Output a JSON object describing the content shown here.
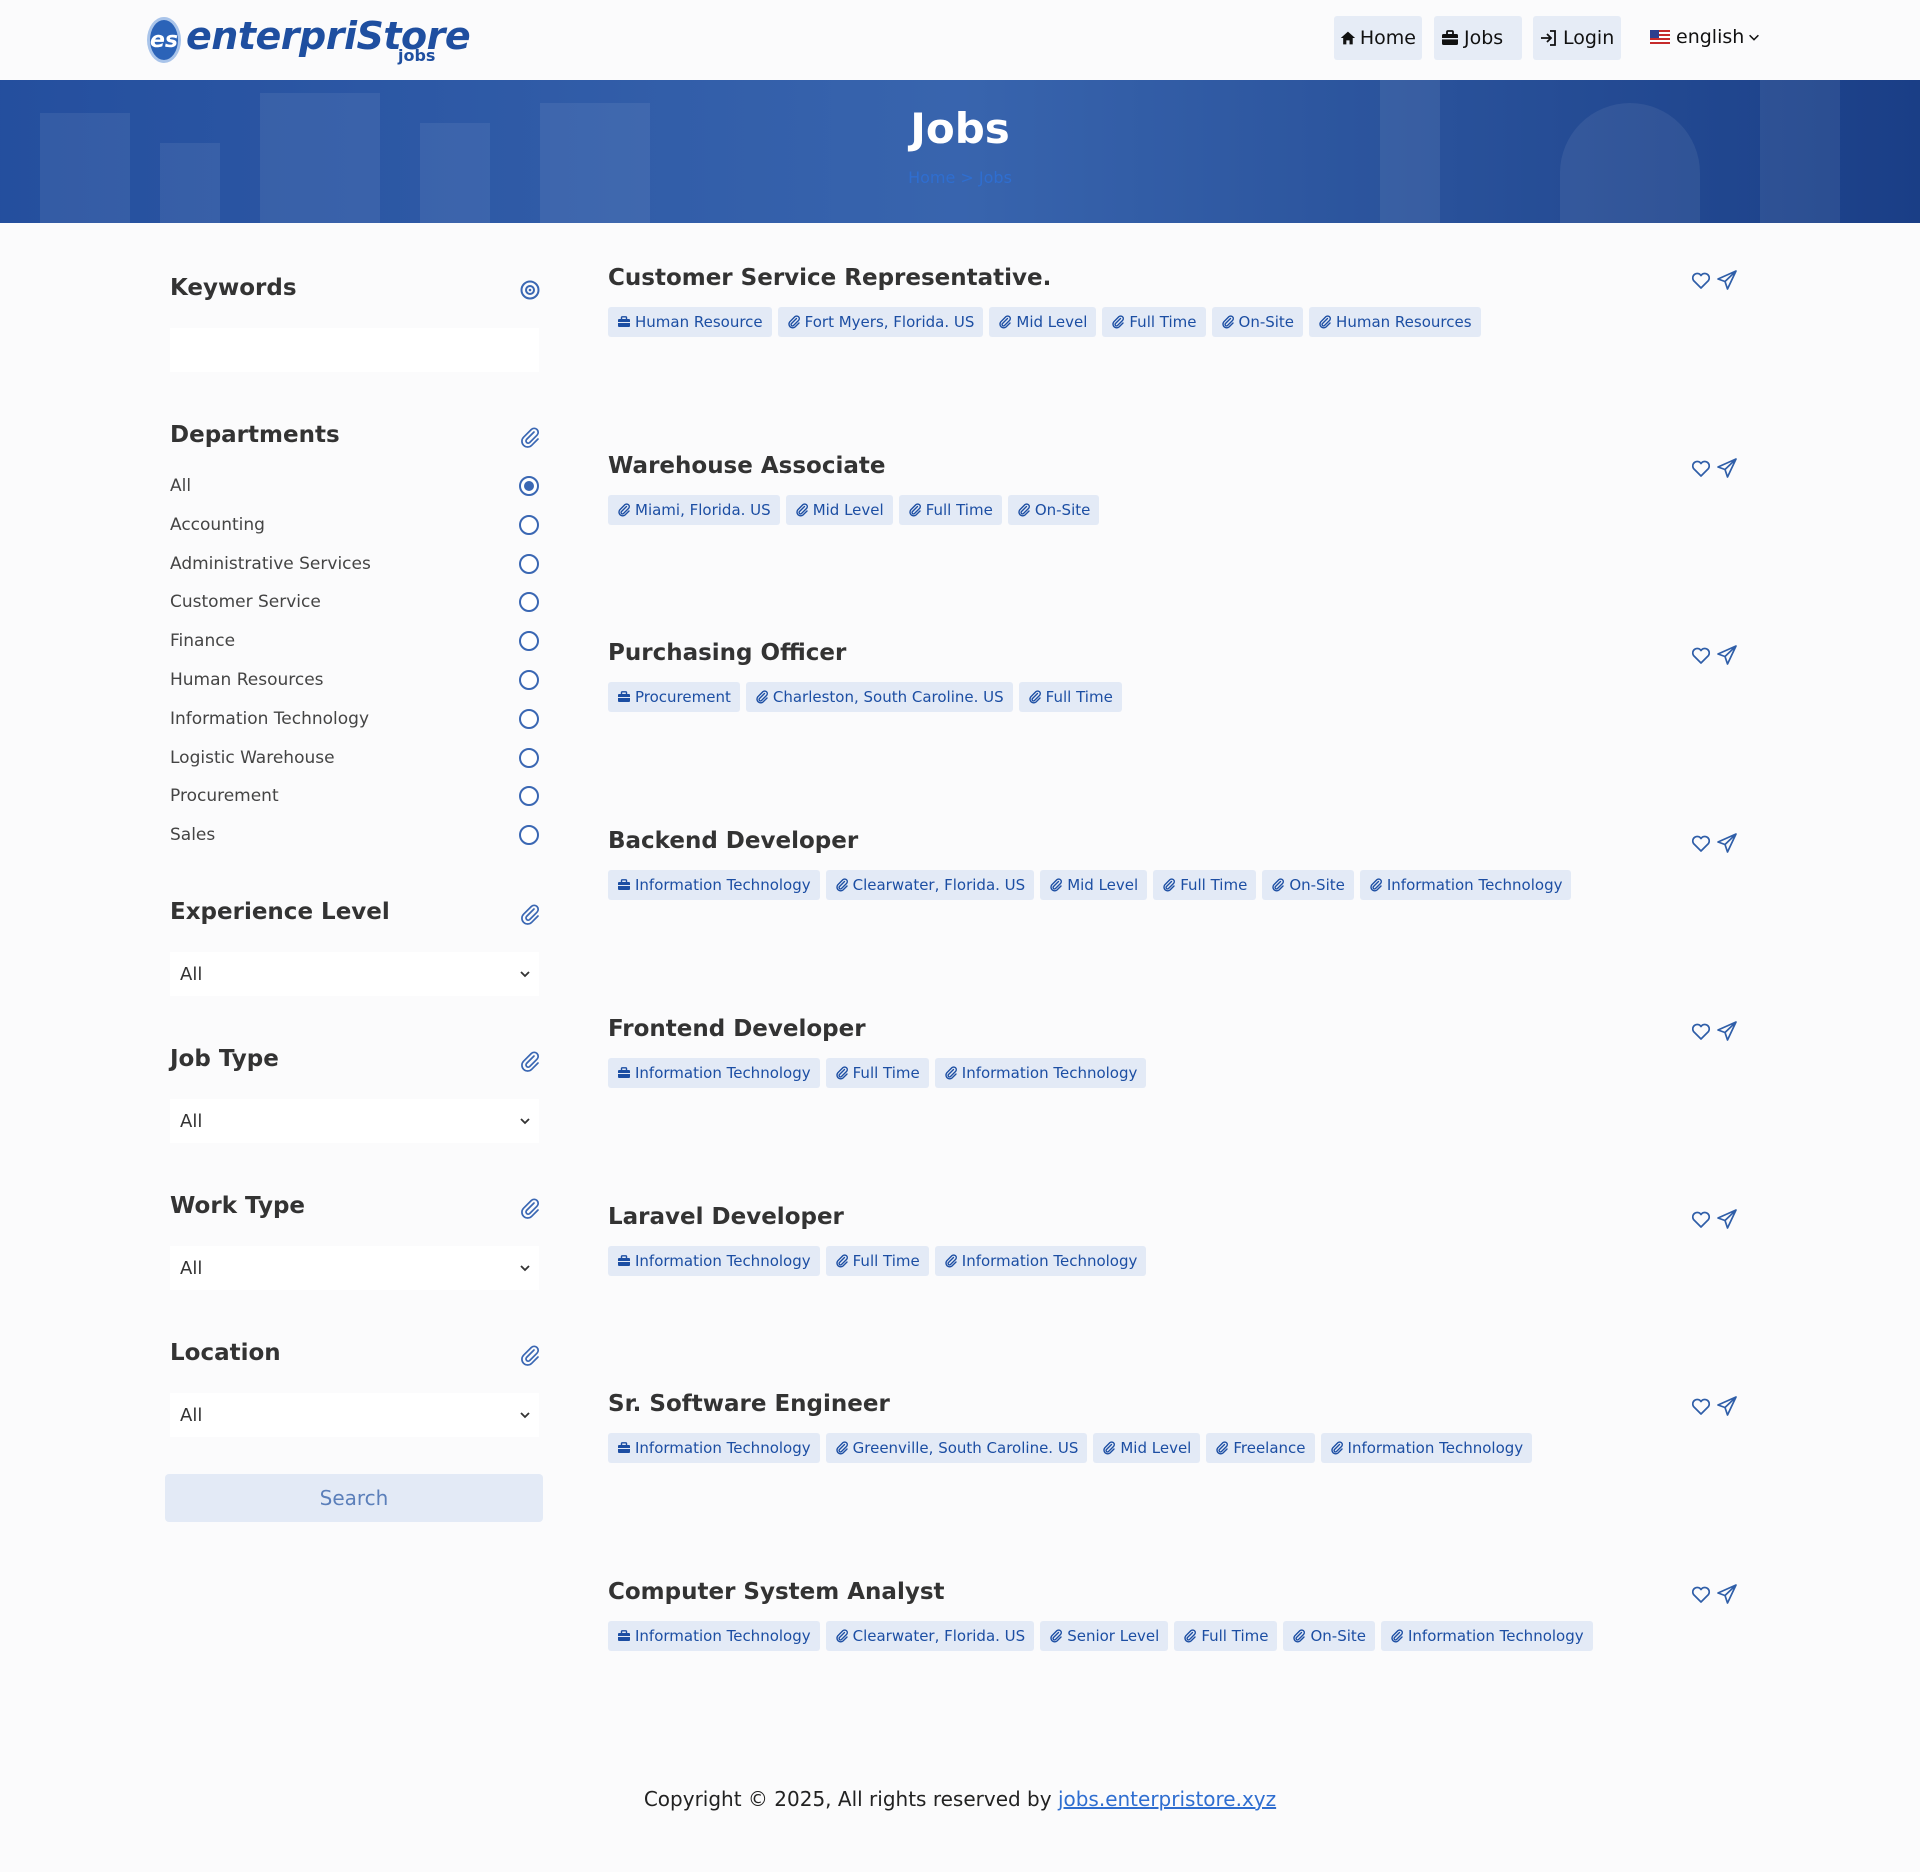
{
  "brand": {
    "logo_badge": "es",
    "logo_text": "enterpriStore",
    "logo_sub": "jobs"
  },
  "nav": {
    "home": "Home",
    "jobs": "Jobs",
    "login": "Login",
    "language": "english"
  },
  "hero": {
    "title": "Jobs",
    "breadcrumb_home": "Home",
    "breadcrumb_sep": ">",
    "breadcrumb_current": "Jobs"
  },
  "sidebar": {
    "keywords_label": "Keywords",
    "keywords_value": "",
    "departments_label": "Departments",
    "departments": [
      "All",
      "Accounting",
      "Administrative Services",
      "Customer Service",
      "Finance",
      "Human Resources",
      "Information Technology",
      "Logistic Warehouse",
      "Procurement",
      "Sales"
    ],
    "selected_department": "All",
    "experience_label": "Experience Level",
    "experience_value": "All",
    "jobtype_label": "Job Type",
    "jobtype_value": "All",
    "worktype_label": "Work Type",
    "worktype_value": "All",
    "location_label": "Location",
    "location_value": "All",
    "search_label": "Search"
  },
  "jobs": [
    {
      "title": "Customer Service Representative.",
      "tags": [
        {
          "icon": "briefcase-icon",
          "text": "Human Resource"
        },
        {
          "icon": "paperclip-icon",
          "text": "Fort Myers, Florida. US"
        },
        {
          "icon": "paperclip-icon",
          "text": "Mid Level"
        },
        {
          "icon": "paperclip-icon",
          "text": "Full Time"
        },
        {
          "icon": "paperclip-icon",
          "text": "On-Site"
        },
        {
          "icon": "paperclip-icon",
          "text": "Human Resources"
        }
      ]
    },
    {
      "title": "Warehouse Associate",
      "tags": [
        {
          "icon": "paperclip-icon",
          "text": "Miami, Florida. US"
        },
        {
          "icon": "paperclip-icon",
          "text": "Mid Level"
        },
        {
          "icon": "paperclip-icon",
          "text": "Full Time"
        },
        {
          "icon": "paperclip-icon",
          "text": "On-Site"
        }
      ]
    },
    {
      "title": "Purchasing Officer",
      "tags": [
        {
          "icon": "briefcase-icon",
          "text": "Procurement"
        },
        {
          "icon": "paperclip-icon",
          "text": "Charleston, South Caroline. US"
        },
        {
          "icon": "paperclip-icon",
          "text": "Full Time"
        }
      ]
    },
    {
      "title": "Backend Developer",
      "tags": [
        {
          "icon": "briefcase-icon",
          "text": "Information Technology"
        },
        {
          "icon": "paperclip-icon",
          "text": "Clearwater, Florida. US"
        },
        {
          "icon": "paperclip-icon",
          "text": "Mid Level"
        },
        {
          "icon": "paperclip-icon",
          "text": "Full Time"
        },
        {
          "icon": "paperclip-icon",
          "text": "On-Site"
        },
        {
          "icon": "paperclip-icon",
          "text": "Information Technology"
        }
      ]
    },
    {
      "title": "Frontend Developer",
      "tags": [
        {
          "icon": "briefcase-icon",
          "text": "Information Technology"
        },
        {
          "icon": "paperclip-icon",
          "text": "Full Time"
        },
        {
          "icon": "paperclip-icon",
          "text": "Information Technology"
        }
      ]
    },
    {
      "title": "Laravel Developer",
      "tags": [
        {
          "icon": "briefcase-icon",
          "text": "Information Technology"
        },
        {
          "icon": "paperclip-icon",
          "text": "Full Time"
        },
        {
          "icon": "paperclip-icon",
          "text": "Information Technology"
        }
      ]
    },
    {
      "title": "Sr. Software Engineer",
      "tags": [
        {
          "icon": "briefcase-icon",
          "text": "Information Technology"
        },
        {
          "icon": "paperclip-icon",
          "text": "Greenville, South Caroline. US"
        },
        {
          "icon": "paperclip-icon",
          "text": "Mid Level"
        },
        {
          "icon": "paperclip-icon",
          "text": "Freelance"
        },
        {
          "icon": "paperclip-icon",
          "text": "Information Technology"
        }
      ]
    },
    {
      "title": "Computer System Analyst",
      "tags": [
        {
          "icon": "briefcase-icon",
          "text": "Information Technology"
        },
        {
          "icon": "paperclip-icon",
          "text": "Clearwater, Florida. US"
        },
        {
          "icon": "paperclip-icon",
          "text": "Senior Level"
        },
        {
          "icon": "paperclip-icon",
          "text": "Full Time"
        },
        {
          "icon": "paperclip-icon",
          "text": "On-Site"
        },
        {
          "icon": "paperclip-icon",
          "text": "Information Technology"
        }
      ]
    }
  ],
  "footer": {
    "text": "Copyright © 2025, All rights reserved by",
    "link": "jobs.enterpristore.xyz"
  },
  "colors": {
    "accent": "#1c4ea3",
    "tag_bg": "#e3eaf6",
    "hero": "#164aa0"
  }
}
